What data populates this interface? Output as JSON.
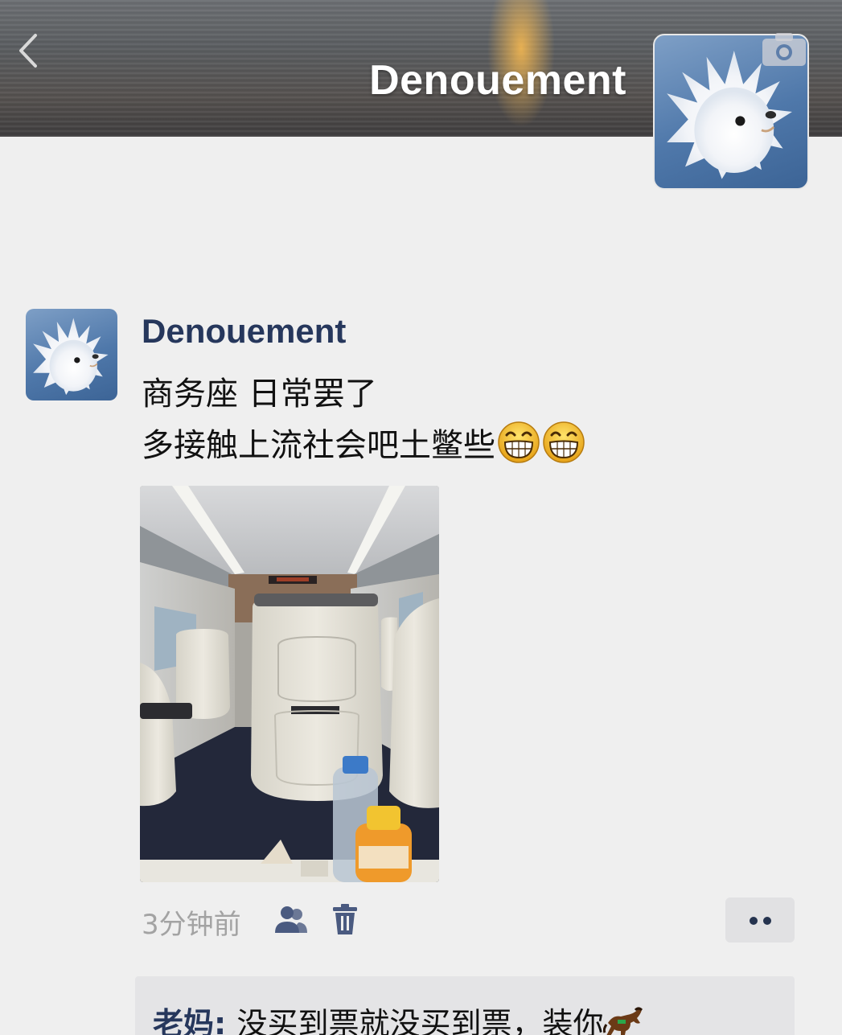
{
  "cover": {
    "name": "Denouement"
  },
  "post": {
    "author": "Denouement",
    "text_line_1": "商务座 日常罢了",
    "text_line_2": "多接触上流社会吧土鳖些",
    "emojis": [
      "grinning-face",
      "grinning-face"
    ],
    "time": "3分钟前"
  },
  "comments": [
    {
      "author": "老妈",
      "separator": ": ",
      "text": "没买到票就没买到票，装你",
      "emoji": "horse"
    }
  ],
  "icons": {
    "back": "chevron-left-icon",
    "camera": "camera-icon",
    "friends": "friends-icon",
    "trash": "trash-icon",
    "more": "more-dots-icon"
  },
  "colors": {
    "name_blue": "#26375c",
    "background": "#efefef",
    "meta_gray": "#a3a3a3"
  }
}
